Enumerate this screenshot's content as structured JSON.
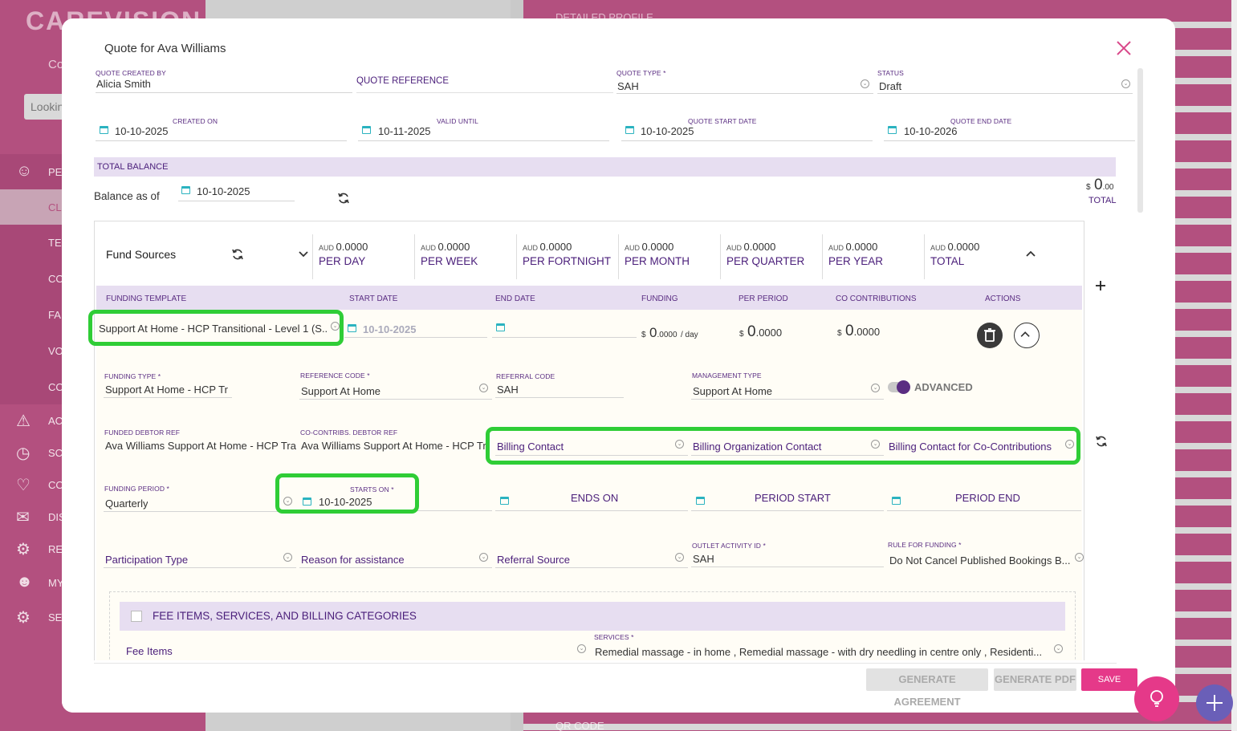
{
  "background": {
    "logo": "CAREVISION",
    "sidebar_co": "Co",
    "search_placeholder": "Lookin",
    "nav_items": [
      "PE",
      "CL",
      "TE",
      "CO",
      "FA",
      "VO",
      "CO",
      "AC",
      "SC",
      "CO",
      "DIS",
      "RE",
      "MY",
      "SE"
    ],
    "right_top_text": "DETAILED PROFILE",
    "right_bottom_text": "QR CODE"
  },
  "modal": {
    "title": "Quote for Ava Williams",
    "header_fields": {
      "quote_created_by_label": "QUOTE CREATED BY",
      "quote_created_by": "Alicia Smith",
      "quote_reference_label": "QUOTE REFERENCE",
      "quote_type_label": "QUOTE TYPE *",
      "quote_type": "SAH",
      "status_label": "STATUS",
      "status": "Draft",
      "created_on_label": "CREATED ON",
      "created_on": "10-10-2025",
      "valid_until_label": "VALID UNTIL",
      "valid_until": "10-11-2025",
      "quote_start_label": "QUOTE START DATE",
      "quote_start": "10-10-2025",
      "quote_end_label": "QUOTE END DATE",
      "quote_end": "10-10-2026"
    },
    "balance": {
      "band_label": "TOTAL BALANCE",
      "as_of_label": "Balance as of",
      "as_of_date": "10-10-2025",
      "currency": "$",
      "amount": "0",
      "amount_dec": ".00",
      "total_label": "TOTAL"
    },
    "fund_sources": {
      "title": "Fund Sources",
      "summary": [
        {
          "currency": "AUD",
          "value": "0.0000",
          "label": "PER DAY"
        },
        {
          "currency": "AUD",
          "value": "0.0000",
          "label": "PER WEEK"
        },
        {
          "currency": "AUD",
          "value": "0.0000",
          "label": "PER FORTNIGHT"
        },
        {
          "currency": "AUD",
          "value": "0.0000",
          "label": "PER MONTH"
        },
        {
          "currency": "AUD",
          "value": "0.0000",
          "label": "PER QUARTER"
        },
        {
          "currency": "AUD",
          "value": "0.0000",
          "label": "PER YEAR"
        },
        {
          "currency": "AUD",
          "value": "0.0000",
          "label": "TOTAL"
        }
      ],
      "columns": [
        "FUNDING TEMPLATE",
        "START DATE",
        "END DATE",
        "FUNDING",
        "PER PERIOD",
        "CO CONTRIBUTIONS",
        "ACTIONS"
      ],
      "row": {
        "funding_template": "Support At Home - HCP Transitional - Level 1 (S...",
        "start_date": "10-10-2025",
        "end_date": "",
        "funding_currency": "$",
        "funding_big": "0",
        "funding_dec": ".0000",
        "funding_unit": "/ day",
        "per_period_currency": "$",
        "per_period_big": "0",
        "per_period_dec": ".0000",
        "co_currency": "$",
        "co_big": "0",
        "co_dec": ".0000"
      },
      "details": {
        "funding_type_label": "FUNDING TYPE *",
        "funding_type": "Support At Home - HCP Tr",
        "reference_code_label": "REFERENCE CODE *",
        "reference_code": "Support At Home",
        "referral_code_label": "REFERRAL CODE",
        "referral_code": "SAH",
        "management_type_label": "MANAGEMENT TYPE",
        "management_type": "Support At Home",
        "advanced_label": "ADVANCED",
        "funded_debtor_label": "FUNDED DEBTOR REF",
        "funded_debtor": "Ava Williams Support At Home - HCP Tra",
        "cocontrib_debtor_label": "CO-CONTRIBS. DEBTOR REF",
        "cocontrib_debtor": "Ava Williams Support At Home - HCP Tr",
        "billing_contact": "Billing Contact",
        "billing_org_contact": "Billing Organization Contact",
        "billing_co_contact": "Billing Contact for Co-Contributions",
        "funding_period_label": "FUNDING PERIOD *",
        "funding_period": "Quarterly",
        "starts_on_label": "STARTS ON *",
        "starts_on": "10-10-2025",
        "ends_on": "ENDS ON",
        "period_start": "PERIOD START",
        "period_end": "PERIOD END",
        "participation_type": "Participation Type",
        "reason_for_assistance": "Reason for assistance",
        "referral_source": "Referral Source",
        "outlet_activity_label": "OUTLET ACTIVITY ID *",
        "outlet_activity": "SAH",
        "rule_for_funding_label": "RULE FOR FUNDING *",
        "rule_for_funding": "Do Not Cancel Published Bookings B..."
      },
      "fee_section": {
        "title": "FEE ITEMS, SERVICES, AND BILLING CATEGORIES",
        "fee_items": "Fee Items",
        "services_label": "SERVICES *",
        "services": "Remedial massage - in home , Remedial massage - with dry needling in centre only , Residenti..."
      }
    },
    "footer": {
      "generate_agreement": "GENERATE AGREEMENT",
      "generate_pdf": "GENERATE PDF",
      "save": "SAVE"
    }
  },
  "colors": {
    "brand_pink": "#e53989",
    "purple": "#4a1e7a",
    "lavender": "#e7def1",
    "highlight_green": "#2fcd36",
    "teal": "#2bb3c0"
  }
}
